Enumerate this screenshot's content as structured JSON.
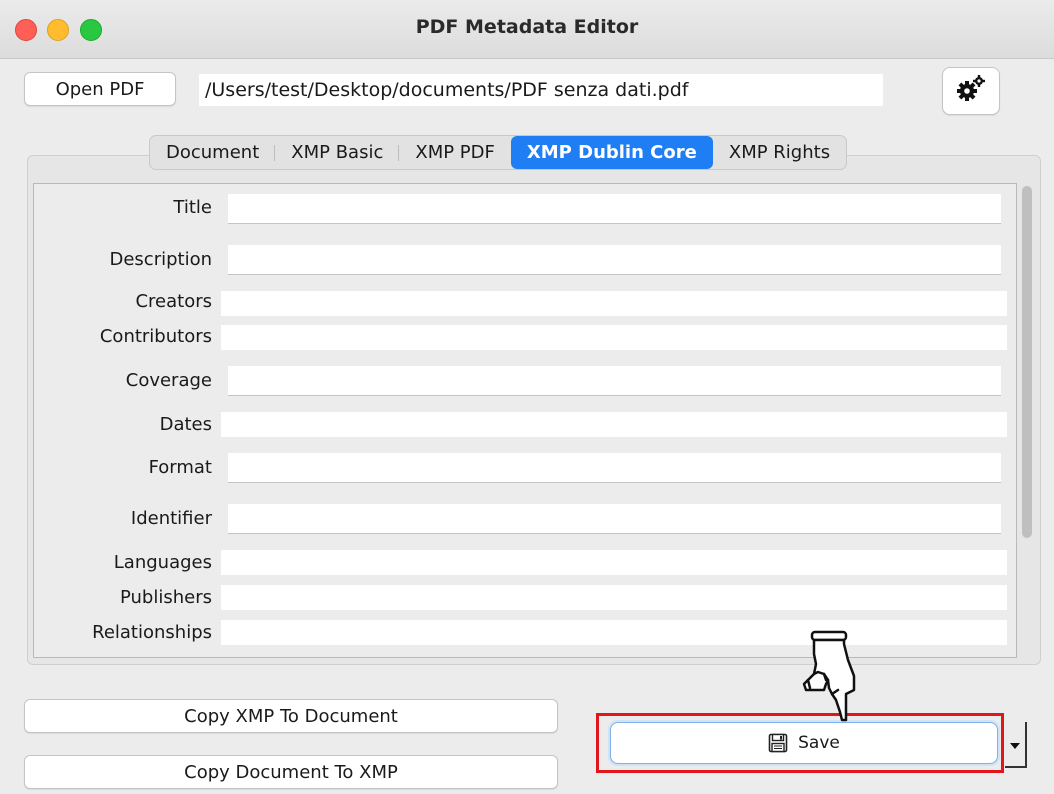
{
  "window": {
    "title": "PDF Metadata Editor"
  },
  "toolbar": {
    "open_label": "Open PDF",
    "file_path": "/Users/test/Desktop/documents/PDF senza dati.pdf",
    "settings_icon": "gear-icon"
  },
  "tabs": [
    {
      "label": "Document",
      "active": false
    },
    {
      "label": "XMP Basic",
      "active": false
    },
    {
      "label": "XMP PDF",
      "active": false
    },
    {
      "label": "XMP Dublin Core",
      "active": true
    },
    {
      "label": "XMP Rights",
      "active": false
    }
  ],
  "fields": [
    {
      "label": "Title",
      "value": ""
    },
    {
      "label": "Description",
      "value": ""
    },
    {
      "label": "Creators",
      "value": ""
    },
    {
      "label": "Contributors",
      "value": ""
    },
    {
      "label": "Coverage",
      "value": ""
    },
    {
      "label": "Dates",
      "value": ""
    },
    {
      "label": "Format",
      "value": ""
    },
    {
      "label": "Identifier",
      "value": ""
    },
    {
      "label": "Languages",
      "value": ""
    },
    {
      "label": "Publishers",
      "value": ""
    },
    {
      "label": "Relationships",
      "value": ""
    }
  ],
  "actions": {
    "copy_xmp_to_doc": "Copy XMP To Document",
    "copy_doc_to_xmp": "Copy Document To XMP",
    "save_label": "Save",
    "save_icon": "floppy-disk-icon",
    "dropdown_icon": "dropdown-arrow-icon"
  },
  "colors": {
    "active_tab": "#1f7ef3",
    "highlight": "#e0161d"
  }
}
